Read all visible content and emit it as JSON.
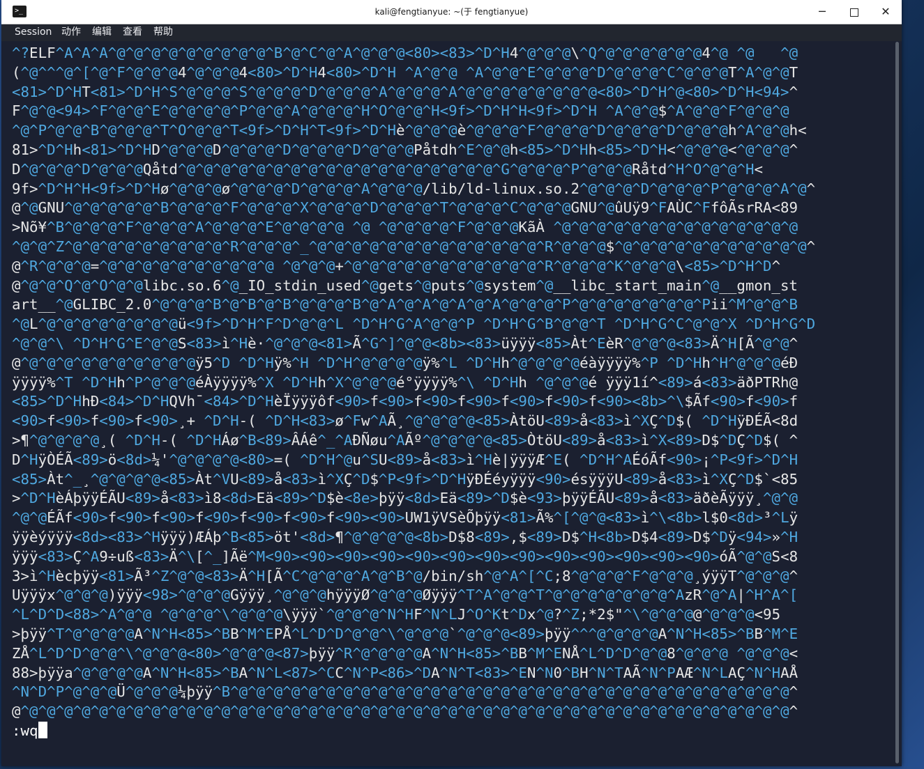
{
  "window": {
    "title": "kali@fengtianyue: ~(于 fengtianyue)",
    "icon": "terminal-icon",
    "minimize_label": "─",
    "close_label": "✕"
  },
  "menu": [
    "Session",
    "动作",
    "编辑",
    "查看",
    "帮助"
  ],
  "colors": {
    "terminal_bg": "#1b2030",
    "control_char_color": "#4fa8e0",
    "text_color": "#e6e6e6"
  },
  "terminal": {
    "lines": [
      "^?ELF^A^A^A^@^@^@^@^@^@^@^@^@^B^@^C^@^A^@^@^@<80><83>^D^H4^@^@^@\\^Q^@^@^@^@^@^@4^@ ^@   ^@",
      "(^@^^^@^[^@^F^@^@^@4^@^@^@4<80>^D^H4<80>^D^H ^A^@^@ ^A^@^@^E^@^@^@^D^@^@^@^C^@^@^@T^A^@^@T",
      "<81>^D^HT<81>^D^H^S^@^@^@^S^@^@^@^D^@^@^@^A^@^@^@^A^@^@^@^@^@^@^@^@<80>^D^H^@<80>^D^H<94>^",
      "F^@^@<94>^F^@^@^E^@^@^@^@^P^@^@^A^@^@^@^H^O^@^@^H<9f>^D^H^H<9f>^D^H ^A^@^@$^A^@^@^F^@^@^@",
      "^@^P^@^@^B^@^@^@^T^O^@^@^T<9f>^D^H^T<9f>^D^Hè^@^@^@è^@^@^@^F^@^@^@^D^@^@^@^D^@^@^@h^A^@^@h<",
      "81>^D^Hh<81>^D^HD^@^@^@D^@^@^@^D^@^@^@^D^@^@^@Påtdh^E^@^@h<85>^D^Hh<85>^D^H<^@^@^@<^@^@^@^",
      "D^@^@^@^D^@^@^@Qåtd^@^@^@^@^@^@^@^@^@^@^@^@^@^@^@^@^@^@^G^@^@^@^P^@^@^@Råtd^H^O^@^@^H<",
      "9f>^D^H^H<9f>^D^Hø^@^@^@ø^@^@^@^D^@^@^@^A^@^@^@/lib/ld-linux.so.2^@^@^@^D^@^@^@^P^@^@^@^A^@^",
      "@^@GNU^@^@^@^@^@^B^@^@^@^F^@^@^@^X^@^@^@^D^@^@^@^T^@^@^@^C^@^@^@GNU^@ûUÿ9^FAÙC^FfôÃsrRA<89",
      ">Nõ¥^B^@^@^@^F^@^@^@^A^@^@^@^E^@^@^@^@ ^@ ^@^@^@^@^F^@^@^@KãÀ ^@^@^@^@^@^@^@^@^@^@^@^@^@^@",
      "^@^@^Z^@^@^@^@^@^@^@^@^@^R^@^@^@^_^@^@^@^@^@^@^@^@^@^@^@^@^@^R^@^@^@$^@^@^@^@^@^@^@^@^@^@^@^",
      "@^R^@^@^@=^@^@^@^@^@^@^@^@^@^@ ^@^@^@+^@^@^@^@^@^@^@^@^@^@^@^R^@^@^@^K^@^@^@\\<85>^D^H^D^",
      "@^@^@^Q^@^O^@^@libc.so.6^@_IO_stdin_used^@gets^@puts^@system^@__libc_start_main^@__gmon_st",
      "art__^@GLIBC_2.0^@^@^@^B^@^B^@^B^@^@^@^B^@^A^@^A^@^A^@^A^@^@^@^P^@^@^@^@^@^@^@^Pii^M^@^@^B",
      "^@L^@^@^@^@^@^@^@^@ü<9f>^D^H^F^D^@^@^L ^D^H^G^A^@^@^P ^D^H^G^B^@^@^T ^D^H^G^C^@^@^X ^D^H^G^D",
      "^@^@^\\ ^D^H^G^E^@^@S<83>ì^Hè·^@^@^@<81>Ã^G^]^@^@<8b><83>üÿÿÿ<85>Àt^EèR^@^@^@<83>Ä^H[Ã^@^@^",
      "@^@^@^@^@^@^@^@^@^@^@ÿ5^D ^D^Hÿ%^H ^D^H^@^@^@^@ÿ%^L ^D^Hh^@^@^@^@éàÿÿÿÿ%^P ^D^Hh^H^@^@^@éÐ",
      "ÿÿÿÿ%^T ^D^Hh^P^@^@^@éÀÿÿÿÿ%^X ^D^Hh^X^@^@^@é°ÿÿÿÿ%^\\ ^D^Hh ^@^@^@é ÿÿÿ1í^<89>á<83>äðPTRh@",
      "<85>^D^HhÐ<84>^D^HQVh¯<84>^D^HèÏÿÿÿôf<90>f<90>f<90>f<90>f<90>f<90>f<90><8b>^\\$Ãf<90>f<90>f",
      "<90>f<90>f<90>f<90>¸+ ^D^H-( ^D^H<83>ø^Fw^AÃ¸^@^@^@^@<85>ÀtöU<89>å<83>ì^XÇ^D$( ^D^HÿÐÉÃ<8d",
      ">¶^@^@^@^@¸( ^D^H-( ^D^HÁø^B<89>ÂÁê^_^AÐÑøu^AÃº^@^@^@^@<85>ÒtöU<89>å<83>ì^X<89>D$^DÇ^D$( ^",
      "D^HÿÒÉÃ<89>ö<8d>¼'^@^@^@^@<80>=( ^D^H^@u^SU<89>å<83>ì^Hè|ÿÿÿÆ^E( ^D^H^AÉóÃf<90>¡^P<9f>^D^H",
      "<85>Àt^_¸^@^@^@^@<85>Àt^VU<89>å<83>ì^XÇ^D$^P<9f>^D^HÿÐÉéyÿÿÿ<90>ésÿÿÿU<89>å<83>ì^XÇ^D$`<85",
      ">^D^HèÁþÿÿÉÃU<89>å<83>ì8<8d>Eä<89>^D$è<8e>þÿÿ<8d>Eä<89>^D$è<93>þÿÿÉÃU<89>å<83>äðèÃÿÿÿ¸^@^@",
      "^@^@ÉÃf<90>f<90>f<90>f<90>f<90>f<90>f<90><90>UW1ÿVSèÕþÿÿ<81>Ã%^[^@^@<83>ì^\\<8b>l$0<8d>³^Lÿ",
      "ÿÿèýÿÿÿ<8d><83>^Hÿÿÿ)ÆÁþ^B<85>öt'<8d>¶^@^@^@^@<8b>D$8<89>,$<89>D$^H<8b>D$4<89>D$^Dÿ<94>»^H",
      "ÿÿÿ<83>Ç^A9÷uß<83>Ä^\\[^_]Ãë^M<90><90><90><90><90><90><90><90><90><90><90><90><90>óÃ^@^@S<8",
      "3>ì^Hècþÿÿ<81>Ã³^Z^@^@<83>Ä^H[Ã^C^@^@^@^A^@^B^@/bin/sh^@^A^[^C;8^@^@^@^F^@^@^@¸ýÿÿT^@^@^@^",
      "Uÿÿÿx^@^@^@)ÿÿÿ<98>^@^@^@Gÿÿÿ¸^@^@^@hÿÿÿØ^@^@^@Øÿÿÿ^T^A^@^@^T^@^@^@^@^@^@^@^AzR^@^A|^H^A^[",
      "^L^D^D<88>^A^@^@ ^@^@^@^\\^@^@^@\\ÿÿÿ`^@^@^@^N^HF^N^LJ^O^Kt^Dx^@?^Z;*2$\"^\\^@^@^@@^@^@^@<95",
      ">þÿÿ^T^@^@^@^@A^N^H<85>^BB^M^EPÅ^L^D^D^@^@^\\^@^@^@`^@^@^@<89>þÿÿ^^^@^@^@^@A^N^H<85>^BB^M^E",
      "ZÅ^L^D^D^@^@^\\^@^@^@<80>^@^@^@<87>þÿÿ^R^@^@^@^@A^N^H<85>^BB^M^ENÅ^L^D^D^@^@8^@^@^@ ^@^@^@<",
      "88>þÿÿa^@^@^@^@A^N^H<85>^BA^N^L<87>^CC^N^P<86>^DA^N^T<83>^EN^N0^BH^N^TAÃ^N^PAÆ^N^LAÇ^N^HAÅ",
      "^N^D^P^@^@^@Ü^@^@^@¼þÿÿ^B^@^@^@^@^@^@^@^@^@^@^@^@^@^@^@^@^@^@^@^@^@^@^@^@^@^@^@^@^@^@^@^@^",
      "@^@^@^@^@^@^@^@^@^@^@^@^@^@^@^@^@^@^@^@^@^@^@^@^@^@^@^@^@^@^@^@^@^@^@^@^@^@^@^@^@^@^@^@^@^"
    ],
    "command": ":wq"
  }
}
